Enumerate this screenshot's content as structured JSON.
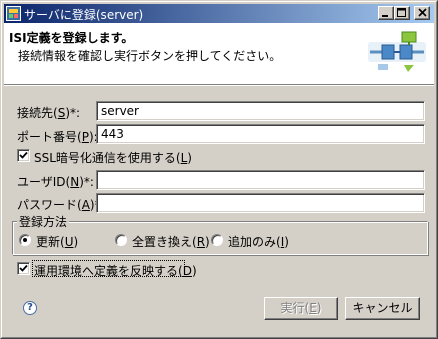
{
  "window": {
    "title": "サーバに登録(server)",
    "controls": {
      "minimize": "_",
      "maximize": "□",
      "close": "×"
    }
  },
  "header": {
    "title": "ISI定義を登録します。",
    "description": "接続情報を確認し実行ボタンを押してください。",
    "banner_icon": "connection-diagram-icon"
  },
  "form": {
    "destination": {
      "label_pre": "接続先(",
      "mnemonic": "S",
      "label_post": ")*:",
      "value": "server"
    },
    "port": {
      "label_pre": "ポート番号(",
      "mnemonic": "P",
      "label_post": "):",
      "value": "443"
    },
    "ssl": {
      "label_pre": "SSL暗号化通信を使用する(",
      "mnemonic": "L",
      "label_post": ")",
      "checked": true
    },
    "user_id": {
      "label_pre": "ユーザID(",
      "mnemonic": "N",
      "label_post": ")*:",
      "value": ""
    },
    "password": {
      "label_pre": "パスワード(",
      "mnemonic": "A",
      "label_post": ")*:",
      "value": ""
    }
  },
  "registration": {
    "group_label": "登録方法",
    "options": [
      {
        "label_pre": "更新(",
        "mnemonic": "U",
        "label_post": ")",
        "selected": true
      },
      {
        "label_pre": "全置き換え(",
        "mnemonic": "R",
        "label_post": ")",
        "selected": false
      },
      {
        "label_pre": "追加のみ(",
        "mnemonic": "I",
        "label_post": ")",
        "selected": false
      }
    ]
  },
  "apply_env": {
    "label_pre": "運用環境へ定義を反映する(",
    "mnemonic": "D",
    "label_post": ")",
    "checked": true
  },
  "buttons": {
    "execute": {
      "label_pre": "実行(",
      "mnemonic": "E",
      "label_post": ")",
      "enabled": false
    },
    "cancel": "キャンセル"
  },
  "help": {
    "icon": "help-icon",
    "glyph": "?"
  },
  "colors": {
    "title_start": "#0a246a",
    "title_end": "#a6caf0",
    "face": "#d4d0c8"
  }
}
